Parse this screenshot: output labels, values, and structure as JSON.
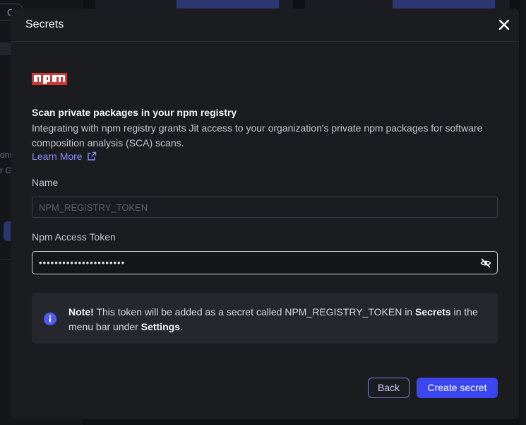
{
  "background": {
    "chip_label": "C",
    "text_1": "ons",
    "text_2": "r G"
  },
  "modal": {
    "title": "Secrets",
    "close_icon": "close-icon",
    "logo_icon": "npm-logo",
    "heading": "Scan private packages in your npm registry",
    "description": "Integrating with npm registry grants Jit access to your organization's private npm packages for software composition analysis (SCA) scans.",
    "learn_more": "Learn More",
    "name_label": "Name",
    "name_placeholder": "NPM_REGISTRY_TOKEN",
    "token_label": "Npm Access Token",
    "token_value": "••••••••••••••••••••••",
    "note": {
      "bold_prefix": "Note!",
      "text_1": " This token will be added as a secret called NPM_REGISTRY_TOKEN in ",
      "secrets_word": "Secrets",
      "text_2": " in the menu bar under ",
      "settings_word": "Settings",
      "text_3": "."
    },
    "back_label": "Back",
    "create_label": "Create secret"
  },
  "colors": {
    "accent": "#3b46f0",
    "link": "#8a8ff5",
    "npm_red": "#cb3837",
    "info_blue": "#4f5af5"
  }
}
